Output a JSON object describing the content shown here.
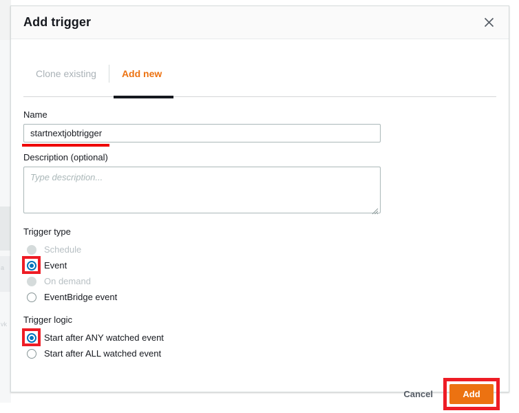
{
  "dialog": {
    "title": "Add trigger",
    "close_icon": "close-icon"
  },
  "tabs": [
    {
      "label": "Clone existing",
      "active": false
    },
    {
      "label": "Add new",
      "active": true
    }
  ],
  "form": {
    "name": {
      "label": "Name",
      "value": "startnextjobtrigger",
      "placeholder": ""
    },
    "description": {
      "label": "Description (optional)",
      "value": "",
      "placeholder": "Type description..."
    }
  },
  "trigger_type": {
    "label": "Trigger type",
    "options": [
      {
        "label": "Schedule",
        "selected": false,
        "disabled": true
      },
      {
        "label": "Event",
        "selected": true,
        "disabled": false
      },
      {
        "label": "On demand",
        "selected": false,
        "disabled": true
      },
      {
        "label": "EventBridge event",
        "selected": false,
        "disabled": false
      }
    ]
  },
  "trigger_logic": {
    "label": "Trigger logic",
    "options": [
      {
        "label": "Start after ANY watched event",
        "selected": true,
        "disabled": false
      },
      {
        "label": "Start after ALL watched event",
        "selected": false,
        "disabled": false
      }
    ]
  },
  "footer": {
    "cancel_label": "Cancel",
    "add_label": "Add"
  },
  "backdrop": {
    "fragment_1": "a",
    "fragment_2": "vk"
  },
  "colors": {
    "accent_orange": "#ec7211",
    "radio_blue": "#0073bb",
    "annotation_red": "#ee1c25",
    "underline_red": "#ee0000",
    "disabled_grey": "#d5dbdb"
  }
}
